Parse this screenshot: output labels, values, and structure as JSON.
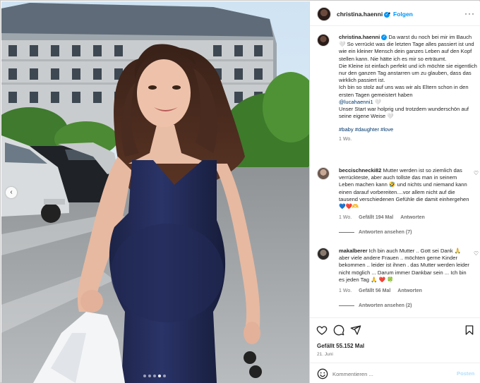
{
  "post": {
    "username": "christina.haenni",
    "follow_label": "Folgen",
    "separator": "•",
    "more_label": "···"
  },
  "caption": {
    "username": "christina.haenni",
    "lines": [
      "Da warst du noch bei mir im Bauch 🤍 So verrückt was die letzten Tage alles passiert ist und wie ein kleiner Mensch dein ganzes Leben auf den Kopf stellen kann. Nie hätte ich es mir so erträumt.",
      "Die Kleine ist einfach perfekt und ich möchte sie eigentlich nur den ganzen Tag anstarren um zu glauben, dass das wirklich passiert ist.",
      "Ich bin so stolz auf uns was wir als Eltern schon in den ersten Tagen gemeistert haben"
    ],
    "mention": "@lucahaenni1",
    "mention_suffix": " 🤍",
    "closing": "Unser Start war holprig und trotzdem wunderschön auf seine eigene Weise 🤍",
    "hashtags": "#baby #daughter #love",
    "time": "1 Wo."
  },
  "comments": [
    {
      "username": "beccischnecki82",
      "text": "Mutter werden ist so ziemlich das verrückteste, aber auch tollste das man in seinem Leben machen kann 🤣 und nichts und niemand kann einen darauf vorbereiten....vor allem nicht auf die tausend verschiedenen Gefühle die damit einhergehen 💙❤️🫶",
      "time": "1 Wo.",
      "likes": "Gefällt 194 Mal",
      "reply": "Antworten",
      "replies": "Antworten ansehen (7)"
    },
    {
      "username": "makalberer",
      "text": "Ich bin auch Mutter .. Gott sei Dank 🙏 aber viele andere Frauen .. möchten gerne Kinder bekommen .. leider ist ihnen . das Mutter werden leider nicht möglich ... Darum immer Dankbar sein ... Ich bin es jeden Tag 🙏 ❤️ 🍀",
      "time": "1 Wo.",
      "likes": "Gefällt 56 Mal",
      "reply": "Antworten",
      "replies": "Antworten ansehen (2)"
    }
  ],
  "footer": {
    "likes": "Gefällt 55.152 Mal",
    "date": "21. Juni",
    "comment_placeholder": "Kommentieren ...",
    "post_label": "Posten"
  },
  "media": {
    "carousel_arrow": "‹",
    "slide_count": 5,
    "active_slide": 4
  }
}
